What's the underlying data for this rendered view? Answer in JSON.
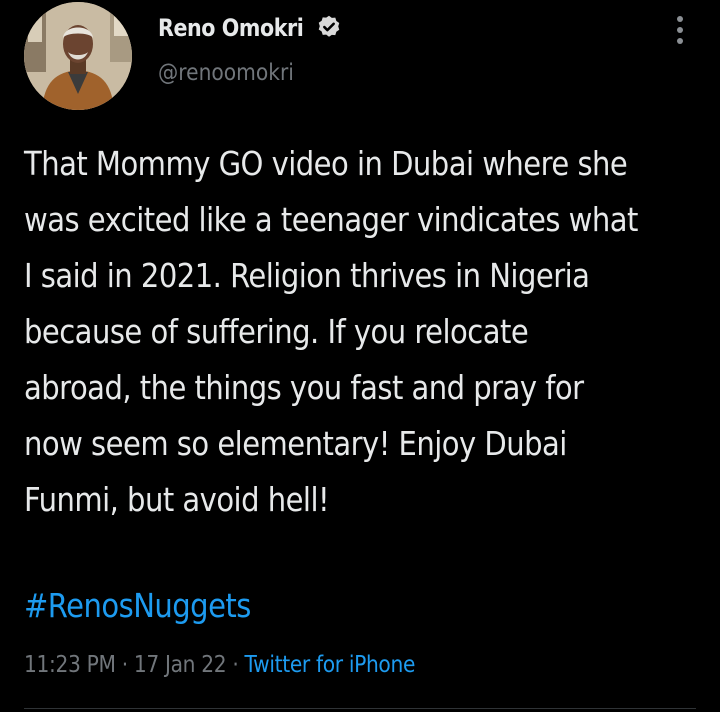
{
  "author": {
    "display_name": "Reno Omokri",
    "handle": "@renoomokri",
    "verified": true,
    "badge_color": "#d9d9d9"
  },
  "tweet": {
    "text": "That Mommy GO video in Dubai where she\nwas excited like a teenager vindicates what\nI said in 2021. Religion thrives in Nigeria\nbecause of suffering. If you relocate\nabroad, the things you fast and pray for\nnow seem so elementary! Enjoy Dubai\nFunmi, but avoid hell!",
    "hashtag": "#RenosNuggets",
    "time": "11:23 PM",
    "date": "17 Jan 22",
    "source": "Twitter for iPhone",
    "separator": " · "
  },
  "icons": {
    "more": "more-vertical-icon",
    "verified": "verified-badge-icon"
  },
  "colors": {
    "background": "#000000",
    "text": "#e7e9ea",
    "secondary": "#71767b",
    "link": "#1d9bf0"
  }
}
